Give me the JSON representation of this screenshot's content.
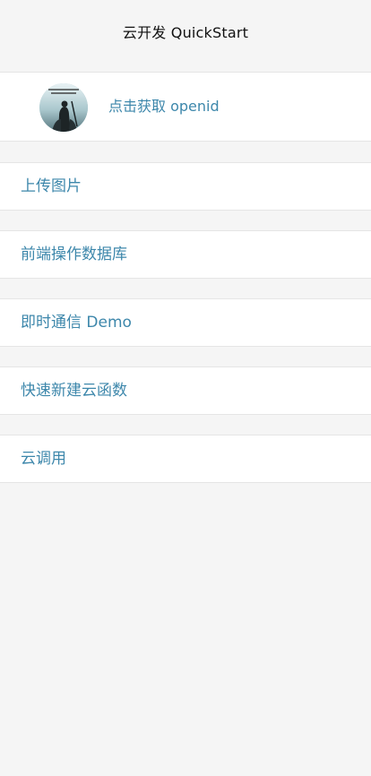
{
  "nav": {
    "title": "云开发 QuickStart"
  },
  "userinfo": {
    "avatar_icon": "avatar-image",
    "openid_label": "点击获取 openid"
  },
  "menu": {
    "items": [
      {
        "label": "上传图片"
      },
      {
        "label": "前端操作数据库"
      },
      {
        "label": "即时通信 Demo"
      },
      {
        "label": "快速新建云函数"
      },
      {
        "label": "云调用"
      }
    ]
  },
  "colors": {
    "background": "#f5f5f5",
    "card": "#ffffff",
    "link": "#3d87ab",
    "title": "#111111",
    "divider": "#e5e5e5"
  }
}
